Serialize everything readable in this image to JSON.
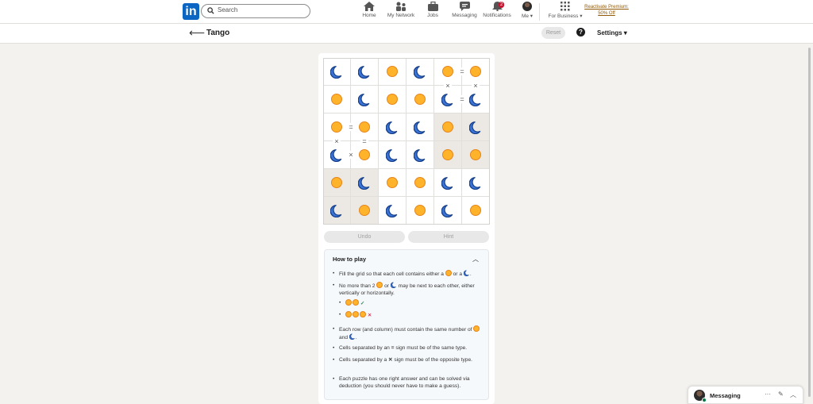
{
  "topnav": {
    "search_placeholder": "Search",
    "items": [
      {
        "label": "Home",
        "icon": "home-icon"
      },
      {
        "label": "My Network",
        "icon": "network-icon"
      },
      {
        "label": "Jobs",
        "icon": "jobs-icon"
      },
      {
        "label": "Messaging",
        "icon": "messaging-icon"
      },
      {
        "label": "Notifications",
        "icon": "bell-icon",
        "badge": "2"
      },
      {
        "label": "Me ▾",
        "icon": "avatar"
      }
    ],
    "business": "For Business ▾",
    "premium": "Reactivate Premium: 50% Off"
  },
  "subbar": {
    "title": "Tango",
    "reset": "Reset",
    "help": "?",
    "settings": "Settings ▾"
  },
  "grid": {
    "cells": [
      [
        "moon",
        "moon",
        "sun",
        "moon",
        "sun",
        "sun"
      ],
      [
        "sun",
        "moon",
        "sun",
        "sun",
        "moon",
        "moon"
      ],
      [
        "sun",
        "sun",
        "moon",
        "moon",
        "sun",
        "moon"
      ],
      [
        "moon",
        "sun",
        "moon",
        "moon",
        "sun",
        "sun"
      ],
      [
        "sun",
        "moon",
        "sun",
        "sun",
        "moon",
        "moon"
      ],
      [
        "moon",
        "sun",
        "moon",
        "sun",
        "moon",
        "sun"
      ]
    ],
    "locked": [
      [
        2,
        4
      ],
      [
        2,
        5
      ],
      [
        3,
        4
      ],
      [
        3,
        5
      ],
      [
        4,
        0
      ],
      [
        4,
        1
      ],
      [
        5,
        0
      ],
      [
        5,
        1
      ]
    ],
    "signs": [
      {
        "between": [
          [
            0,
            4
          ],
          [
            0,
            5
          ]
        ],
        "symbol": "="
      },
      {
        "between": [
          [
            0,
            4
          ],
          [
            1,
            4
          ]
        ],
        "symbol": "×"
      },
      {
        "between": [
          [
            0,
            5
          ],
          [
            1,
            5
          ]
        ],
        "symbol": "×"
      },
      {
        "between": [
          [
            1,
            4
          ],
          [
            1,
            5
          ]
        ],
        "symbol": "="
      },
      {
        "between": [
          [
            2,
            0
          ],
          [
            2,
            1
          ]
        ],
        "symbol": "="
      },
      {
        "between": [
          [
            2,
            0
          ],
          [
            3,
            0
          ]
        ],
        "symbol": "×"
      },
      {
        "between": [
          [
            2,
            1
          ],
          [
            3,
            1
          ]
        ],
        "symbol": "="
      },
      {
        "between": [
          [
            3,
            0
          ],
          [
            3,
            1
          ]
        ],
        "symbol": "×"
      }
    ]
  },
  "buttons": {
    "undo": "Undo",
    "hint": "Hint"
  },
  "howto": {
    "title": "How to play",
    "r1a": "Fill the grid so that each cell contains either a",
    "r1b": "or a",
    "r2a": "No more than 2",
    "r2b": "or",
    "r2c": "may be next to each other, either vertically or horizontally.",
    "check": "✓",
    "cross": "✕",
    "r3a": "Each row (and column) must contain the same number of",
    "r3b": "and",
    "r4a": "Cells separated by an",
    "r4eq": "=",
    "r4b": "sign must be of the same type.",
    "r5a": "Cells separated by a",
    "r5x": "✕",
    "r5b": "sign must be of the opposite type.",
    "r6": "Each puzzle has one right answer and can be solved via deduction (you should never have to make a guess)."
  },
  "messaging": {
    "label": "Messaging",
    "more": "···",
    "compose": "✎",
    "collapse": "︿"
  }
}
